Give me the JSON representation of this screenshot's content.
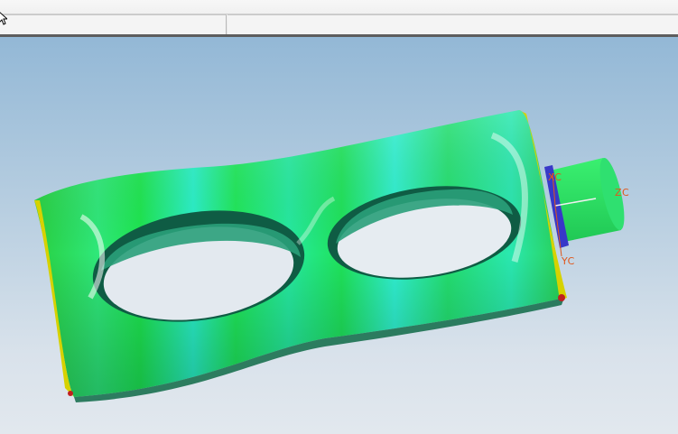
{
  "viewport": {
    "axes": {
      "x_label": "XC",
      "y_label": "YC",
      "z_label": "ZC",
      "color": "#e0571c"
    },
    "model": {
      "icon": "eyeglass-shaped-part-icon",
      "colors": [
        "#22e055",
        "#2af0c8",
        "#1a9a6a",
        "#d8d000",
        "#c02020",
        "#3030c0"
      ]
    }
  }
}
